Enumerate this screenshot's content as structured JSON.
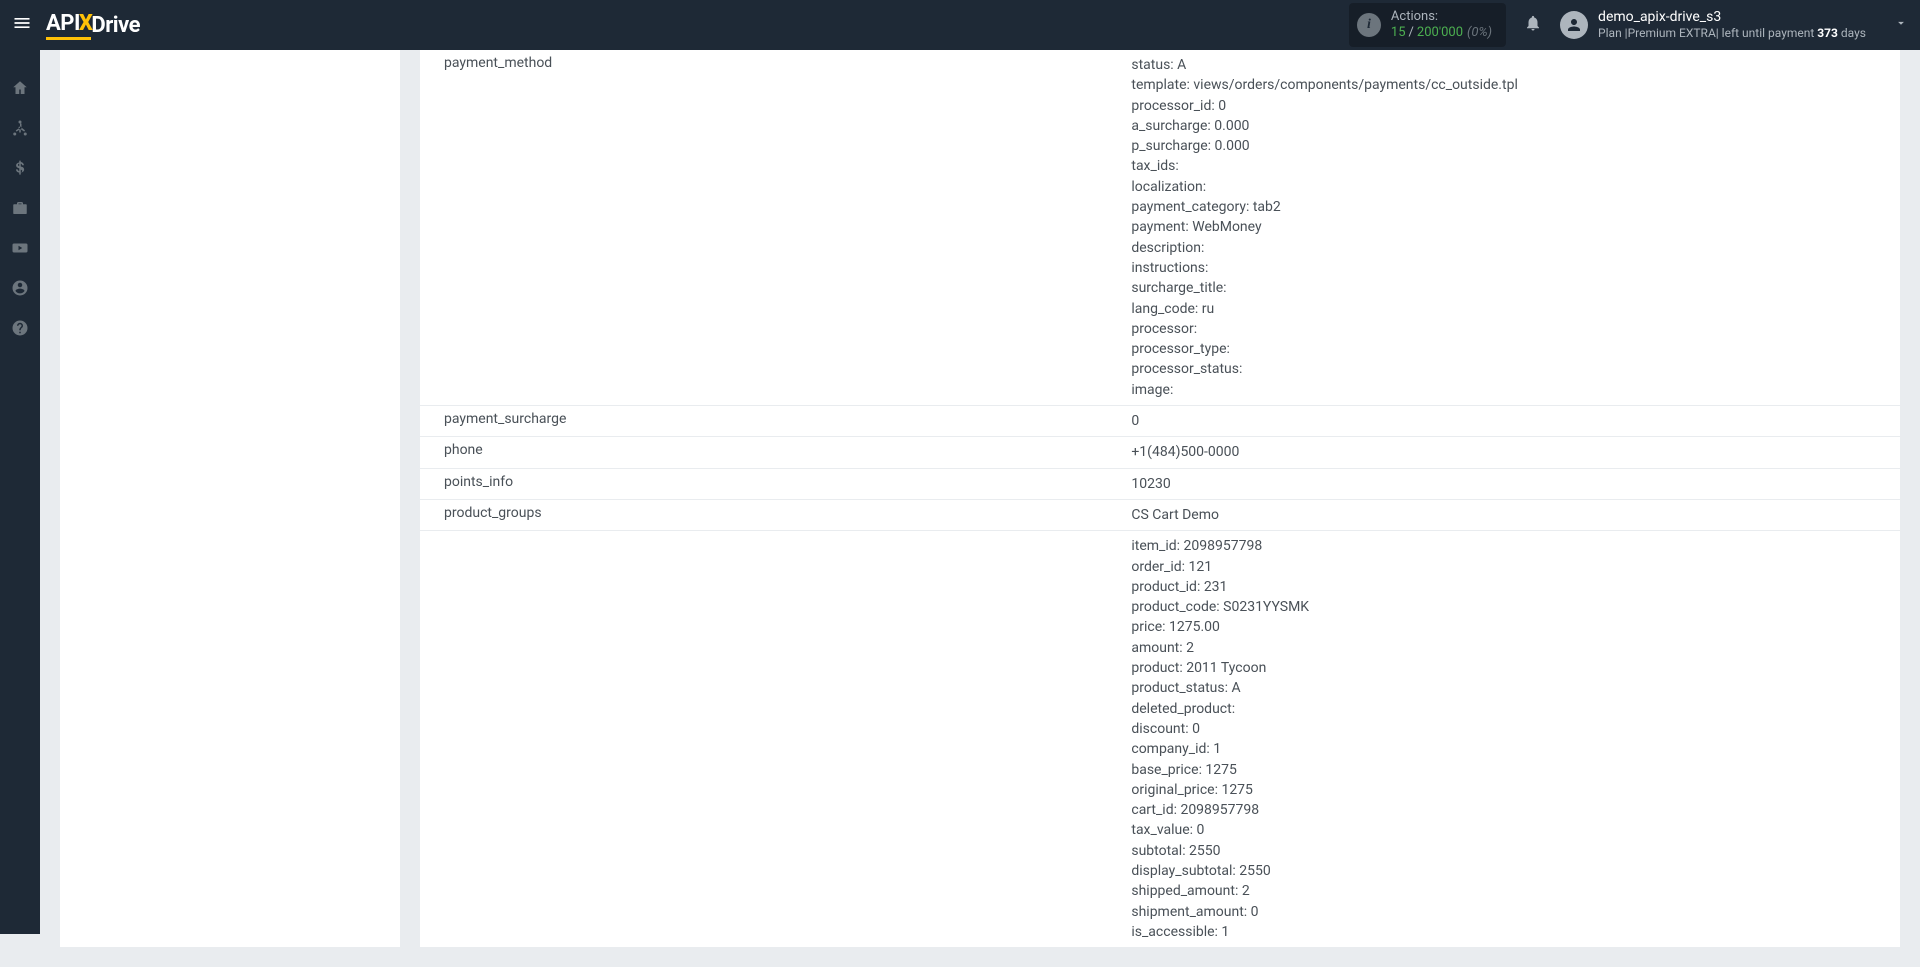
{
  "topbar": {
    "logo": {
      "p1": "API",
      "p2": "X",
      "p3": "Drive"
    },
    "actions": {
      "label": "Actions:",
      "used": "15",
      "slash": "/",
      "total": "200'000",
      "percent": "(0%)"
    },
    "user": {
      "name": "demo_apix-drive_s3",
      "plan_prefix": "Plan |Premium EXTRA| left until payment ",
      "plan_days": "373",
      "plan_suffix": " days"
    }
  },
  "rows": [
    {
      "key": "payment_method",
      "value": "status: A\ntemplate: views/orders/components/payments/cc_outside.tpl\nprocessor_id: 0\na_surcharge: 0.000\np_surcharge: 0.000\ntax_ids:\nlocalization:\npayment_category: tab2\npayment: WebMoney\ndescription:\ninstructions:\nsurcharge_title:\nlang_code: ru\nprocessor:\nprocessor_type:\nprocessor_status:\nimage:",
      "multiline": true
    },
    {
      "key": "payment_surcharge",
      "value": "0"
    },
    {
      "key": "phone",
      "value": "+1(484)500-0000"
    },
    {
      "key": "points_info",
      "value": "10230"
    },
    {
      "key": "product_groups",
      "value": "CS Cart Demo"
    },
    {
      "key": "",
      "value": "item_id: 2098957798\norder_id: 121\nproduct_id: 231\nproduct_code: S0231YYSMK\nprice: 1275.00\namount: 2\nproduct: 2011 Tycoon\nproduct_status: A\ndeleted_product:\ndiscount: 0\ncompany_id: 1\nbase_price: 1275\noriginal_price: 1275\ncart_id: 2098957798\ntax_value: 0\nsubtotal: 2550\ndisplay_subtotal: 2550\nshipped_amount: 2\nshipment_amount: 0\nis_accessible: 1",
      "multiline": true,
      "noBorder": true
    }
  ]
}
